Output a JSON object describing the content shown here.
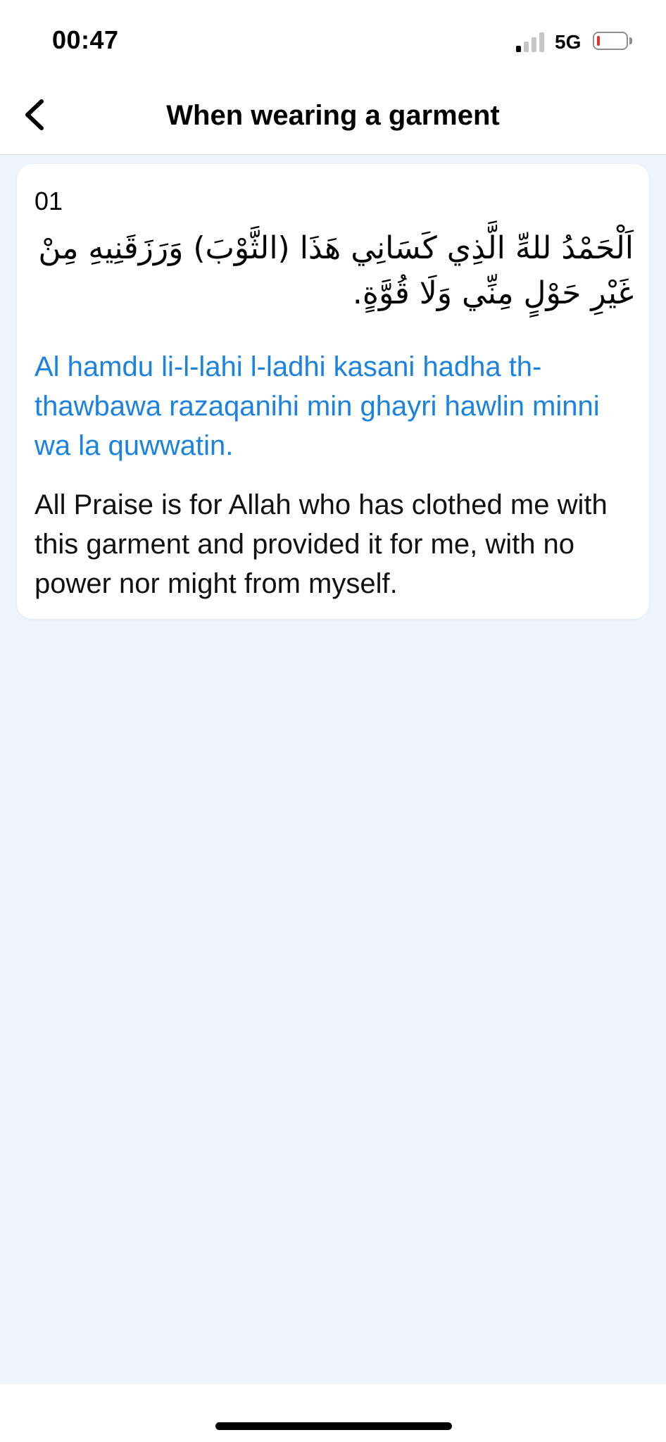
{
  "status_bar": {
    "time": "00:47",
    "network": "5G",
    "signal_bars_active": 1,
    "signal_bars_total": 4,
    "battery_level_fraction": 0.05,
    "battery_color": "#e5312c"
  },
  "nav": {
    "back_icon": "chevron-left-icon",
    "title": "When wearing a garment"
  },
  "dua": {
    "number": "01",
    "arabic": "اَلْحَمْدُ للهِّ الَّذِي كَسَانِي هَذَا (الثَّوْبَ) وَرَزَقَنِيهِ مِنْ غَيْرِ حَوْلٍ مِنِّي وَلَا قُوَّةٍ.",
    "transliteration": "Al hamdu li-l-lahi l-ladhi kasani hadha th-thawbawa razaqanihi min ghayri hawlin minni wa la quwwatin.",
    "translation": "All Praise is for Allah who has clothed me with this garment and provided it for me, with no power nor might from myself."
  },
  "colors": {
    "accent": "#1b82e0",
    "background": "#eef4fb",
    "card": "#ffffff"
  }
}
